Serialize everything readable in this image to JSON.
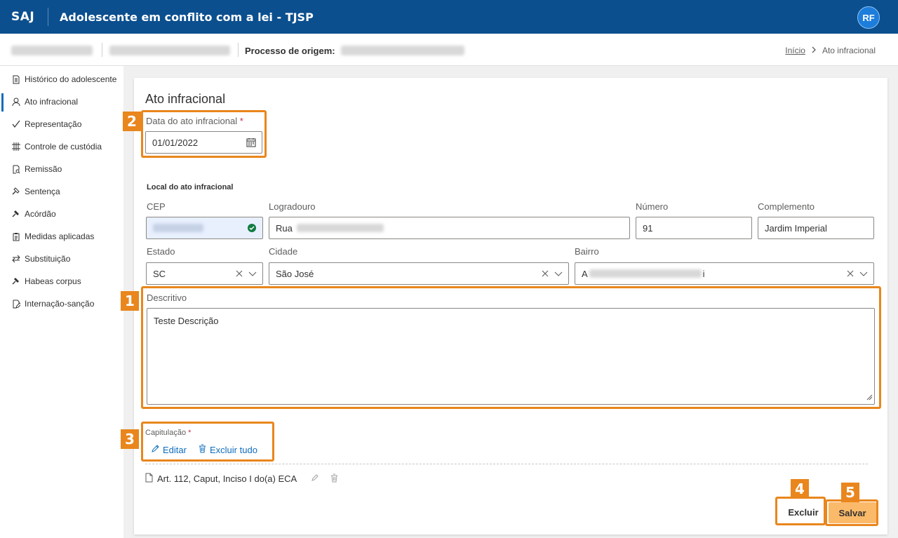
{
  "app": {
    "brand": "SAJ",
    "title": "Adolescente em conflito com a lei - TJSP",
    "user_initials": "RF"
  },
  "subheader": {
    "process_label": "Processo de origem:"
  },
  "breadcrumb": {
    "home": "Início",
    "current": "Ato infracional"
  },
  "sidebar": {
    "items": [
      {
        "label": "Histórico do adolescente",
        "icon": "document-icon"
      },
      {
        "label": "Ato infracional",
        "icon": "person-icon",
        "active": true
      },
      {
        "label": "Representação",
        "icon": "check-icon"
      },
      {
        "label": "Controle de custódia",
        "icon": "grid-icon"
      },
      {
        "label": "Remissão",
        "icon": "document-search-icon"
      },
      {
        "label": "Sentença",
        "icon": "gavel-icon"
      },
      {
        "label": "Acórdão",
        "icon": "gavel-icon"
      },
      {
        "label": "Medidas aplicadas",
        "icon": "clipboard-icon"
      },
      {
        "label": "Substituição",
        "icon": "swap-icon"
      },
      {
        "label": "Habeas corpus",
        "icon": "gavel-icon"
      },
      {
        "label": "Internação-sanção",
        "icon": "document-edit-icon"
      }
    ]
  },
  "form": {
    "title": "Ato infracional",
    "date": {
      "label": "Data do ato infracional",
      "required_mark": "*",
      "value": "01/01/2022"
    },
    "location_title": "Local do ato infracional",
    "cep": {
      "label": "CEP"
    },
    "logradouro": {
      "label": "Logradouro",
      "value": "Rua"
    },
    "numero": {
      "label": "Número",
      "value": "91"
    },
    "complemento": {
      "label": "Complemento",
      "value": "Jardim Imperial"
    },
    "estado": {
      "label": "Estado",
      "value": "SC"
    },
    "cidade": {
      "label": "Cidade",
      "value": "São José"
    },
    "bairro": {
      "label": "Bairro",
      "value_start": "A",
      "value_end": "i"
    },
    "descritivo": {
      "label": "Descritivo",
      "value": "Teste Descrição"
    },
    "capitulacao": {
      "label": "Capitulação",
      "required_mark": "*",
      "edit_label": "Editar",
      "delete_all_label": "Excluir tudo",
      "items": [
        {
          "text": "Art. 112, Caput, Inciso I do(a) ECA"
        }
      ]
    }
  },
  "buttons": {
    "delete": "Excluir",
    "save": "Salvar"
  },
  "badges": [
    "1",
    "2",
    "3",
    "4",
    "5"
  ],
  "colors": {
    "header": "#0b4f8f",
    "highlight": "#e9861d",
    "save_fill": "#fbb96a",
    "accent": "#0f6cbd"
  }
}
